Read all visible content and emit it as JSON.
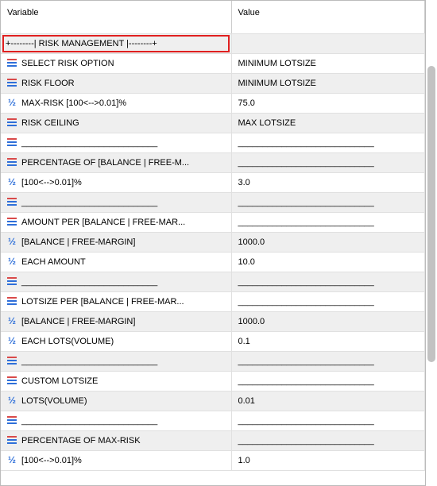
{
  "header": {
    "variable": "Variable",
    "value": "Value"
  },
  "rows": [
    {
      "icon": "none",
      "label": "+--------| RISK MANAGEMENT |--------+",
      "value": "",
      "highlight": true
    },
    {
      "icon": "text",
      "label": "SELECT RISK OPTION",
      "value": "MINIMUM LOTSIZE"
    },
    {
      "icon": "text",
      "label": "RISK FLOOR",
      "value": "MINIMUM LOTSIZE"
    },
    {
      "icon": "half",
      "label": "MAX-RISK [100<-->0.01]%",
      "value": "75.0"
    },
    {
      "icon": "text",
      "label": "RISK CEILING",
      "value": "MAX LOTSIZE"
    },
    {
      "icon": "text",
      "label": "____________________________",
      "value": "____________________________"
    },
    {
      "icon": "text",
      "label": "PERCENTAGE OF [BALANCE | FREE-M...",
      "value": "____________________________"
    },
    {
      "icon": "half",
      "label": "[100<-->0.01]%",
      "value": "3.0"
    },
    {
      "icon": "text",
      "label": "____________________________",
      "value": "____________________________"
    },
    {
      "icon": "text",
      "label": "AMOUNT PER [BALANCE | FREE-MAR...",
      "value": "____________________________"
    },
    {
      "icon": "half",
      "label": "[BALANCE | FREE-MARGIN]",
      "value": "1000.0"
    },
    {
      "icon": "half",
      "label": "EACH AMOUNT",
      "value": "10.0"
    },
    {
      "icon": "text",
      "label": "____________________________",
      "value": "____________________________"
    },
    {
      "icon": "text",
      "label": "LOTSIZE PER [BALANCE | FREE-MAR...",
      "value": "____________________________"
    },
    {
      "icon": "half",
      "label": "[BALANCE | FREE-MARGIN]",
      "value": "1000.0"
    },
    {
      "icon": "half",
      "label": "EACH LOTS(VOLUME)",
      "value": "0.1"
    },
    {
      "icon": "text",
      "label": "____________________________",
      "value": "____________________________"
    },
    {
      "icon": "text",
      "label": "CUSTOM LOTSIZE",
      "value": "____________________________"
    },
    {
      "icon": "half",
      "label": "LOTS(VOLUME)",
      "value": "0.01"
    },
    {
      "icon": "text",
      "label": "____________________________",
      "value": "____________________________"
    },
    {
      "icon": "text",
      "label": "PERCENTAGE OF MAX-RISK",
      "value": "____________________________"
    },
    {
      "icon": "half",
      "label": "[100<-->0.01]%",
      "value": "1.0"
    }
  ]
}
